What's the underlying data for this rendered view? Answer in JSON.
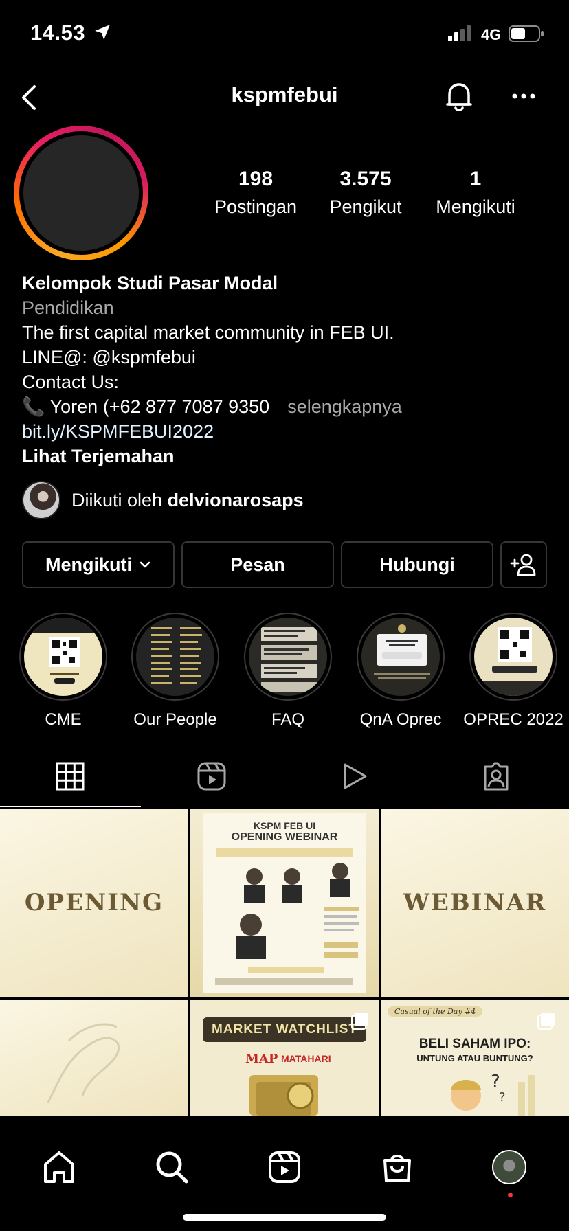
{
  "status_bar": {
    "time": "14.53",
    "network": "4G"
  },
  "header": {
    "username": "kspmfebui"
  },
  "stats": [
    {
      "value": "198",
      "label": "Postingan"
    },
    {
      "value": "3.575",
      "label": "Pengikut"
    },
    {
      "value": "1",
      "label": "Mengikuti"
    }
  ],
  "bio": {
    "name": "Kelompok Studi Pasar Modal",
    "category": "Pendidikan",
    "line1": "The first capital market community in FEB UI.",
    "line2": "LINE@: @kspmfebui",
    "line3": "Contact Us:",
    "line4": "📞 Yoren (+62 877 7087 9350",
    "more": "selengkapnya",
    "link": "bit.ly/KSPMFEBUI2022",
    "translate": "Lihat Terjemahan"
  },
  "followed_by": {
    "prefix": "Diikuti oleh ",
    "user": "delvionarosaps"
  },
  "buttons": {
    "following": "Mengikuti",
    "message": "Pesan",
    "contact": "Hubungi"
  },
  "highlights": [
    {
      "label": "CME"
    },
    {
      "label": "Our People"
    },
    {
      "label": "FAQ"
    },
    {
      "label": "QnA Oprec"
    },
    {
      "label": "OPREC 2022"
    }
  ],
  "posts": {
    "opening": "OPENING",
    "webinar_header": "KSPM FEB UI",
    "webinar_title": "OPENING WEBINAR",
    "webinar": "WEBINAR",
    "watchlist": "MARKET WATCHLIST",
    "watchlist_brand1": "MAP",
    "watchlist_brand2": "MATAHARI",
    "casual_tag": "Casual of the Day #4",
    "ipo_title": "BELI SAHAM IPO:",
    "ipo_sub": "UNTUNG ATAU BUNTUNG?"
  }
}
